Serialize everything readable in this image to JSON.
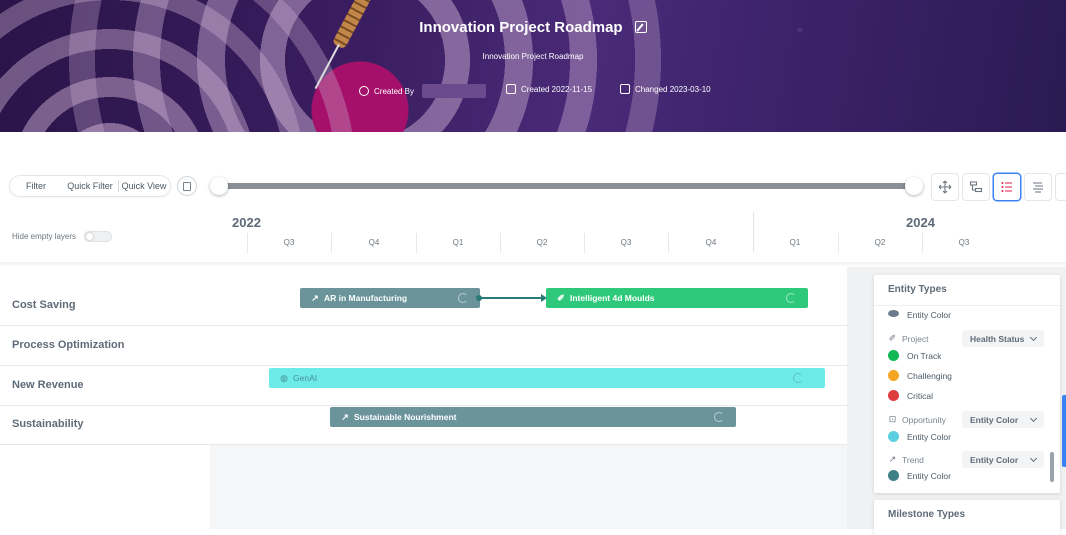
{
  "header": {
    "title": "Innovation Project Roadmap",
    "subtitle": "Innovation Project Roadmap",
    "created_by_label": "Created By",
    "created_label": "Created 2022-11-15",
    "changed_label": "Changed 2023-03-10"
  },
  "toolbar": {
    "filter": "Filter",
    "quick_filter": "Quick Filter",
    "quick_view": "Quick View"
  },
  "timeline": {
    "hide_empty_label": "Hide empty layers",
    "years": [
      "2022",
      "2024"
    ],
    "quarters": [
      "Q3",
      "Q4",
      "Q1",
      "Q2",
      "Q3",
      "Q4",
      "Q1",
      "Q2",
      "Q3"
    ]
  },
  "rows": [
    "Cost Saving",
    "Process Optimization",
    "New Revenue",
    "Sustainability"
  ],
  "bars": {
    "ar": "AR in Manufacturing",
    "moulds": "Intelligent 4d Moulds",
    "genai": "GenAI",
    "sustainable": "Sustainable Nourishment"
  },
  "legend": {
    "title": "Entity Types",
    "entity_color_cut": "Entity Color",
    "project_label": "Project",
    "project_select": "Health Status",
    "on_track": "On Track",
    "challenging": "Challenging",
    "critical": "Critical",
    "opportunity_label": "Opportunity",
    "opportunity_select": "Entity Color",
    "opportunity_color": "Entity Color",
    "trend_label": "Trend",
    "trend_select": "Entity Color",
    "trend_color": "Entity Color",
    "milestone_title": "Milestone Types"
  },
  "colors": {
    "trend_bar": "#6a939a",
    "project_bar": "#2ec97a",
    "opportunity_bar": "#6cebe8",
    "on_track": "#10b955",
    "challenging": "#f5a623",
    "critical": "#dc3c3c",
    "opportunity": "#5ad0e0",
    "trend": "#3f7f86"
  }
}
